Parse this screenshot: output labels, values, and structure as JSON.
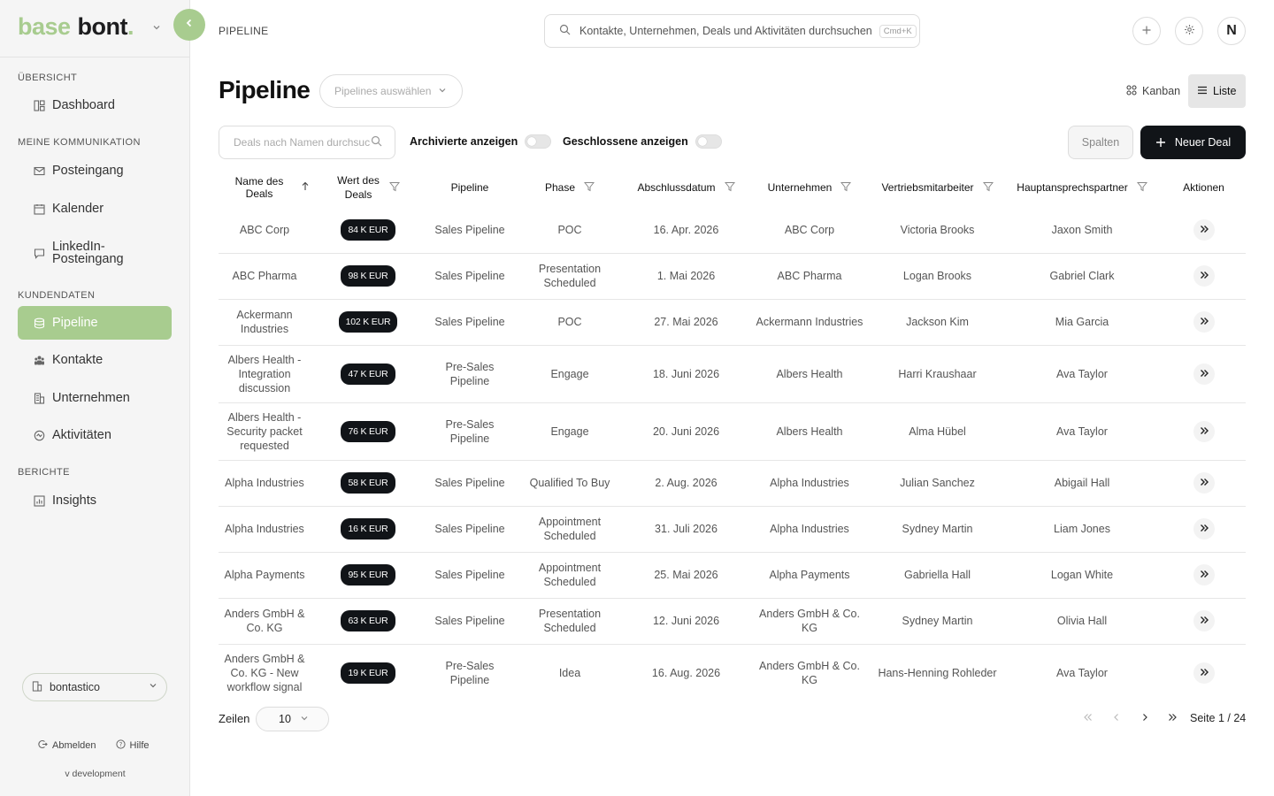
{
  "brand": {
    "part1": "base",
    "part2": "bont",
    "dot": ".",
    "accent": "#a8cc8f"
  },
  "breadcrumb": "PIPELINE",
  "global_search": {
    "placeholder": "Kontakte, Unternehmen, Deals und Aktivitäten durchsuchen",
    "shortcut": "Cmd+K"
  },
  "avatar_initial": "N",
  "sidebar": {
    "sections": [
      {
        "title": "ÜBERSICHT",
        "items": [
          {
            "label": "Dashboard",
            "icon": "dashboard-icon"
          }
        ]
      },
      {
        "title": "MEINE KOMMUNIKATION",
        "items": [
          {
            "label": "Posteingang",
            "icon": "mail-icon"
          },
          {
            "label": "Kalender",
            "icon": "calendar-icon"
          },
          {
            "label": "LinkedIn-Posteingang",
            "icon": "chat-icon"
          }
        ]
      },
      {
        "title": "KUNDENDATEN",
        "items": [
          {
            "label": "Pipeline",
            "icon": "database-icon",
            "active": true
          },
          {
            "label": "Kontakte",
            "icon": "people-icon"
          },
          {
            "label": "Unternehmen",
            "icon": "building-icon"
          },
          {
            "label": "Aktivitäten",
            "icon": "activity-icon"
          }
        ]
      },
      {
        "title": "BERICHTE",
        "items": [
          {
            "label": "Insights",
            "icon": "chart-icon"
          }
        ]
      }
    ],
    "org": "bontastico",
    "logout": "Abmelden",
    "help": "Hilfe",
    "version": "v development"
  },
  "page": {
    "title": "Pipeline",
    "pipeline_select_placeholder": "Pipelines auswählen",
    "views": {
      "kanban": "Kanban",
      "list": "Liste",
      "active": "list"
    }
  },
  "filters": {
    "search_placeholder": "Deals nach Namen durchsuchen",
    "archived_label": "Archivierte anzeigen",
    "archived_on": false,
    "closed_label": "Geschlossene anzeigen",
    "closed_on": false,
    "columns_button": "Spalten",
    "new_deal_button": "Neuer Deal"
  },
  "table": {
    "headers": {
      "name": "Name des Deals",
      "value": "Wert des Deals",
      "pipeline": "Pipeline",
      "phase": "Phase",
      "close_date": "Abschlussdatum",
      "company": "Unternehmen",
      "sales_rep": "Vertriebsmitarbeiter",
      "main_contact": "Hauptansprechspartner",
      "actions": "Aktionen"
    },
    "rows": [
      {
        "name": "ABC Corp",
        "value": "84 K EUR",
        "pipeline": "Sales Pipeline",
        "phase": "POC",
        "date": "16. Apr. 2026",
        "company": "ABC Corp",
        "rep": "Victoria Brooks",
        "contact": "Jaxon Smith"
      },
      {
        "name": "ABC Pharma",
        "value": "98 K EUR",
        "pipeline": "Sales Pipeline",
        "phase": "Presentation Scheduled",
        "date": "1. Mai 2026",
        "company": "ABC Pharma",
        "rep": "Logan Brooks",
        "contact": "Gabriel Clark"
      },
      {
        "name": "Ackermann Industries",
        "value": "102 K EUR",
        "pipeline": "Sales Pipeline",
        "phase": "POC",
        "date": "27. Mai 2026",
        "company": "Ackermann Industries",
        "rep": "Jackson Kim",
        "contact": "Mia Garcia"
      },
      {
        "name": "Albers Health - Integration discussion",
        "value": "47 K EUR",
        "pipeline": "Pre-Sales Pipeline",
        "phase": "Engage",
        "date": "18. Juni 2026",
        "company": "Albers Health",
        "rep": "Harri Kraushaar",
        "contact": "Ava Taylor"
      },
      {
        "name": "Albers Health - Security packet requested",
        "value": "76 K EUR",
        "pipeline": "Pre-Sales Pipeline",
        "phase": "Engage",
        "date": "20. Juni 2026",
        "company": "Albers Health",
        "rep": "Alma Hübel",
        "contact": "Ava Taylor"
      },
      {
        "name": "Alpha Industries",
        "value": "58 K EUR",
        "pipeline": "Sales Pipeline",
        "phase": "Qualified To Buy",
        "date": "2. Aug. 2026",
        "company": "Alpha Industries",
        "rep": "Julian Sanchez",
        "contact": "Abigail Hall"
      },
      {
        "name": "Alpha Industries",
        "value": "16 K EUR",
        "pipeline": "Sales Pipeline",
        "phase": "Appointment Scheduled",
        "date": "31. Juli 2026",
        "company": "Alpha Industries",
        "rep": "Sydney Martin",
        "contact": "Liam Jones"
      },
      {
        "name": "Alpha Payments",
        "value": "95 K EUR",
        "pipeline": "Sales Pipeline",
        "phase": "Appointment Scheduled",
        "date": "25. Mai 2026",
        "company": "Alpha Payments",
        "rep": "Gabriella Hall",
        "contact": "Logan White"
      },
      {
        "name": "Anders GmbH & Co. KG",
        "value": "63 K EUR",
        "pipeline": "Sales Pipeline",
        "phase": "Presentation Scheduled",
        "date": "12. Juni 2026",
        "company": "Anders GmbH & Co. KG",
        "rep": "Sydney Martin",
        "contact": "Olivia Hall"
      },
      {
        "name": "Anders GmbH & Co. KG - New workflow signal",
        "value": "19 K EUR",
        "pipeline": "Pre-Sales Pipeline",
        "phase": "Idea",
        "date": "16. Aug. 2026",
        "company": "Anders GmbH & Co. KG",
        "rep": "Hans-Henning Rohleder",
        "contact": "Ava Taylor"
      }
    ]
  },
  "pagination": {
    "rows_label": "Zeilen",
    "rows_per_page": "10",
    "page_info": "Seite 1 / 24"
  }
}
